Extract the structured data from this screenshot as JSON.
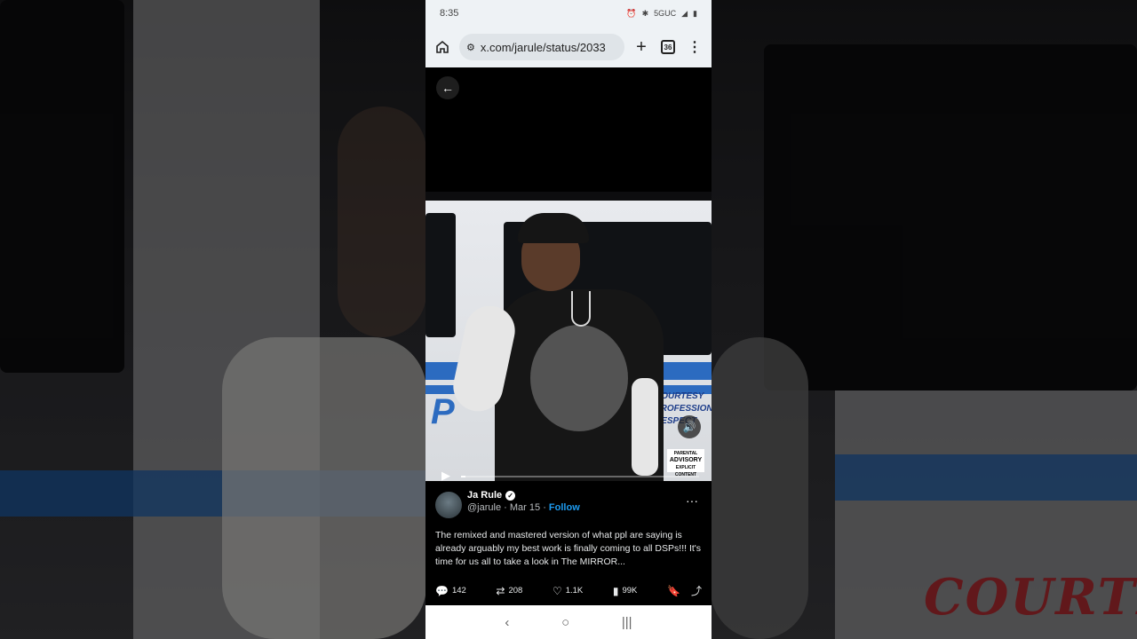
{
  "status_bar": {
    "time": "8:35",
    "network": "5GUC"
  },
  "browser": {
    "url": "x.com/jarule/status/2033",
    "tab_count": "36"
  },
  "media": {
    "advisory_line1": "PARENTAL",
    "advisory_line2": "ADVISORY",
    "advisory_line3": "EXPLICIT CONTENT",
    "van_text": "P",
    "van_side_text": [
      "COURTESY",
      "PROFESSIONALISM",
      "RESPECT"
    ],
    "playback_progress": 0.02
  },
  "tweet": {
    "display_name": "Ja Rule",
    "handle": "@jarule",
    "date": "Mar 15",
    "follow_label": "Follow",
    "text": "The remixed and mastered version of what ppl are saying is already arguably my best work is finally coming to all DSPs!!! It's time for us all to take a look in The MIRROR...",
    "replies": "142",
    "reposts": "208",
    "likes": "1.1K",
    "views": "99K"
  },
  "backdrop": {
    "text": "COURTESY"
  }
}
